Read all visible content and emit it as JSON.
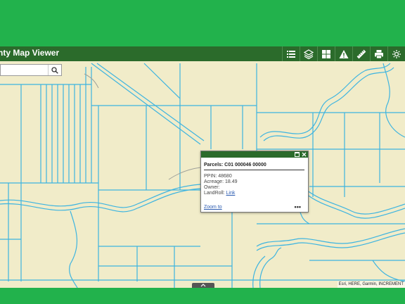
{
  "header": {
    "title": "nty Map Viewer",
    "tools": [
      {
        "icon": "list-icon"
      },
      {
        "icon": "layers-icon"
      },
      {
        "icon": "basemap-grid-icon"
      },
      {
        "icon": "warning-icon"
      },
      {
        "icon": "measure-ruler-icon"
      },
      {
        "icon": "print-icon"
      },
      {
        "icon": "settings-icon"
      }
    ]
  },
  "search": {
    "placeholder": "",
    "value": ""
  },
  "popup": {
    "title": "Parcels: C01 000046 00000",
    "fields": [
      {
        "label": "PPIN:",
        "value": "48680"
      },
      {
        "label": "Acreage:",
        "value": "18.49"
      },
      {
        "label": "Owner:",
        "value": ""
      },
      {
        "label": "LandRoll:",
        "value": "Link"
      }
    ],
    "zoom_label": "Zoom to",
    "more_label": "•••"
  },
  "attribution": "Esri, HERE, Garmin, INCREMENT",
  "colors": {
    "banner": "#22b24c",
    "header": "#2b6b2b",
    "map_bg": "#f1ecc9",
    "parcel_line": "#3db4e0"
  }
}
